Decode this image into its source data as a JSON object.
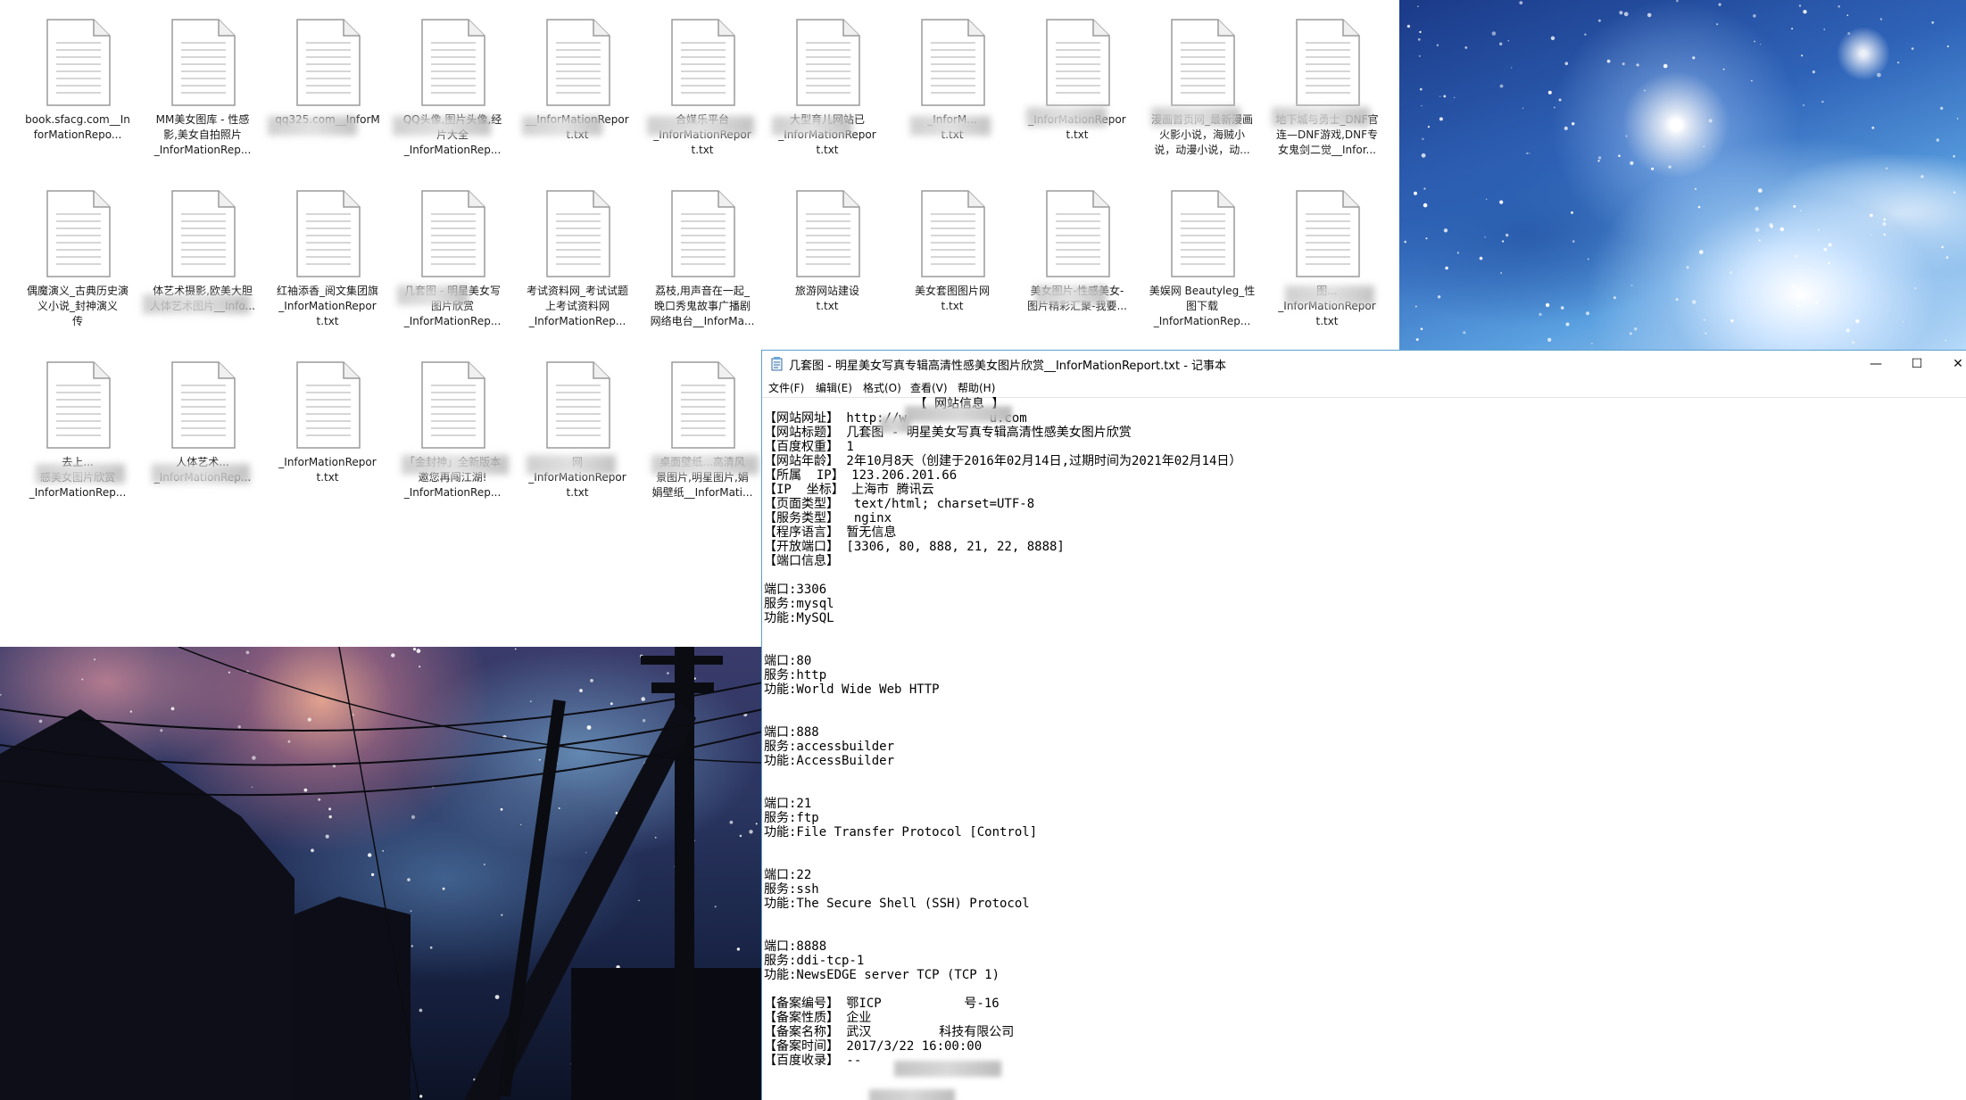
{
  "explorer": {
    "files": [
      {
        "label": "book.sfacg.com__In\nforMationRepo..."
      },
      {
        "label": "MM美女图库 - 性感\n影,美女自拍照片\n_InforMationRep..."
      },
      {
        "label": "qq325.com__InforM"
      },
      {
        "label": "QQ头像,图片头像,经\n片大全\n_InforMationRep..."
      },
      {
        "label": "__InforMationRepor\nt.txt"
      },
      {
        "label": "合媒乐平台\n_InforMationRepor\nt.txt"
      },
      {
        "label": "大型育儿网站已\n_InforMationRepor\nt.txt"
      },
      {
        "label": "_InforM...\nt.txt"
      },
      {
        "label": "_InforMationRepor\nt.txt"
      },
      {
        "label": "漫画首页网_最新漫画\n火影小说，海贼小\n说，动漫小说，动..."
      },
      {
        "label": "地下城与勇士_DNF官\n连—DNF游戏,DNF专\n女鬼剑二觉__Infor..."
      },
      {
        "label": "偶魔演义_古典历史演\n义小说_封神演义\n传\n_InforMationRep..."
      },
      {
        "label": "体艺术摄影,欧美大胆\n人体艺术图片__Info..."
      },
      {
        "label": "红袖添香_阅文集团旗\n_InforMationRepor\nt.txt"
      },
      {
        "label": "几套图 - 明星美女写\n图片欣赏\n_InforMationRep..."
      },
      {
        "label": "考试资料网_考试试题\n上考试资料网\n_InforMationRep..."
      },
      {
        "label": "荔枝,用声音在一起_\n晚口秀鬼故事广播剧\n网络电台__InforMa..."
      },
      {
        "label": "旅游网站建设\nt.txt"
      },
      {
        "label": "美女套图图片网\nt.txt"
      },
      {
        "label": "美女图片-性感美女-\n图片精彩汇聚-我要..."
      },
      {
        "label": "美娱网 Beautyleg_性\n图下载\n_InforMationRep..."
      },
      {
        "label": "图...\n_InforMationRepor\nt.txt"
      },
      {
        "label": "去上...\n感美女图片欣赏\n_InforMationRep..."
      },
      {
        "label": "人体艺术...\n_InforMationRep..."
      },
      {
        "label": "_InforMationRepor\nt.txt"
      },
      {
        "label": "「金封神」全新版本\n邀您再闯江湖!\n_InforMationRep..."
      },
      {
        "label": "网\n_InforMationRepor\nt.txt"
      },
      {
        "label": "桌面壁纸...高清风\n景图片,明星图片,娟\n娟壁纸__InforMati..."
      }
    ]
  },
  "notepad": {
    "title": "几套图 - 明星美女写真专辑高清性感美女图片欣赏__InforMationReport.txt - 记事本",
    "menu": [
      "文件(F)",
      "编辑(E)",
      "格式(O)",
      "查看(V)",
      "帮助(H)"
    ],
    "window_buttons": {
      "minimize": "—",
      "maximize": "☐",
      "close": "✕"
    },
    "lines": [
      "                    【 网站信息 】",
      "【网站网址】 http://w           u.com",
      "【网站标题】 几套图 - 明星美女写真专辑高清性感美女图片欣赏",
      "【百度权重】 1",
      "【网站年龄】 2年10月8天（创建于2016年02月14日,过期时间为2021年02月14日）",
      "【所属  IP】 123.206.201.66",
      "【IP  坐标】 上海市 腾讯云",
      "【页面类型】  text/html; charset=UTF-8",
      "【服务类型】  nginx",
      "【程序语言】 暂无信息",
      "【开放端口】 [3306, 80, 888, 21, 22, 8888]",
      "【端口信息】",
      "",
      "端口:3306",
      "服务:mysql",
      "功能:MySQL",
      "",
      "",
      "端口:80",
      "服务:http",
      "功能:World Wide Web HTTP",
      "",
      "",
      "端口:888",
      "服务:accessbuilder",
      "功能:AccessBuilder",
      "",
      "",
      "端口:21",
      "服务:ftp",
      "功能:File Transfer Protocol [Control]",
      "",
      "",
      "端口:22",
      "服务:ssh",
      "功能:The Secure Shell (SSH) Protocol",
      "",
      "",
      "端口:8888",
      "服务:ddi-tcp-1",
      "功能:NewsEDGE server TCP (TCP 1)",
      "",
      "【备案编号】 鄂ICP           号-16",
      "【备案性质】 企业",
      "【备案名称】 武汉         科技有限公司",
      "【备案时间】 2017/3/22 16:00:00",
      "【百度收录】 --"
    ]
  }
}
